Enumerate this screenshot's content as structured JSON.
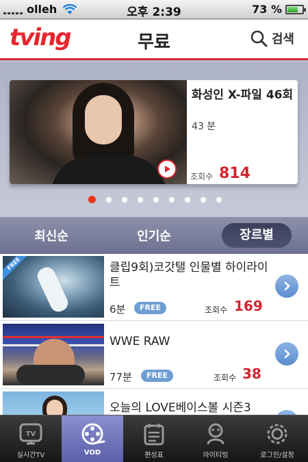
{
  "status_bar": {
    "carrier": "olleh",
    "time": "오후 2:39",
    "battery": "73 %",
    "battery_level": 0.73
  },
  "header": {
    "logo": "tving",
    "title": "무료",
    "search_label": "검색"
  },
  "featured": {
    "title": "화성인 X-파일 46회",
    "duration": "43 분",
    "views_label": "조회수",
    "views": "814",
    "pager_total": 9,
    "pager_active": 1
  },
  "sort_tabs": [
    {
      "label": "최신순",
      "active": false
    },
    {
      "label": "인기순",
      "active": false
    },
    {
      "label": "장르별",
      "active": true
    }
  ],
  "list": [
    {
      "title": "클립9회)코갓탤 인물별 하이라이트",
      "duration": "6분",
      "badge": "FREE",
      "ribbon": "FREE",
      "views_label": "조회수",
      "views": "169"
    },
    {
      "title": "WWE RAW",
      "duration": "77분",
      "badge": "FREE",
      "ribbon": "",
      "views_label": "조회수",
      "views": "38"
    },
    {
      "title": "오늘의 LOVE베이스볼 시즌3",
      "duration": "",
      "badge": "",
      "ribbon": "",
      "views_label": "",
      "views": ""
    }
  ],
  "tabbar": [
    {
      "label": "실시간TV",
      "icon": "tv-icon",
      "active": false
    },
    {
      "label": "VOD",
      "icon": "film-reel-icon",
      "active": true
    },
    {
      "label": "편성표",
      "icon": "schedule-icon",
      "active": false
    },
    {
      "label": "마이티빙",
      "icon": "my-tving-icon",
      "active": false
    },
    {
      "label": "로그인/설정",
      "icon": "gear-icon",
      "active": false
    }
  ]
}
